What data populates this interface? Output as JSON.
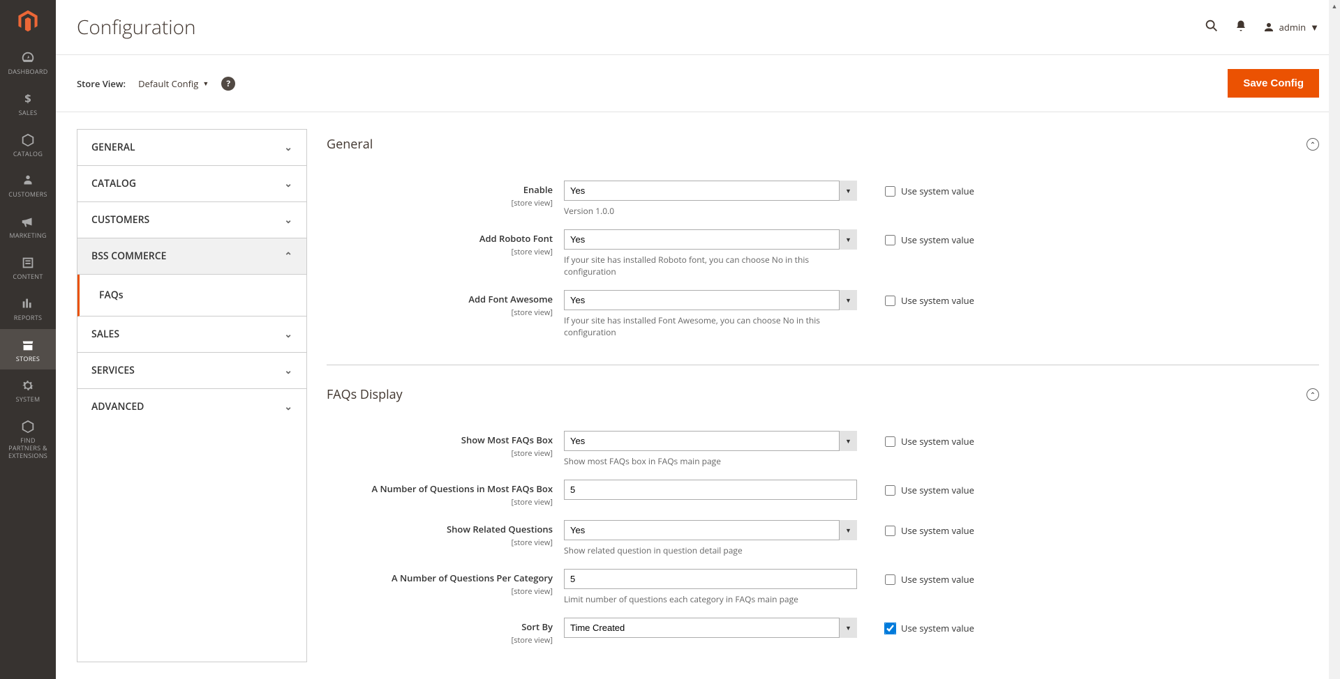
{
  "sidebar": {
    "items": [
      {
        "label": "DASHBOARD",
        "name": "nav-dashboard"
      },
      {
        "label": "SALES",
        "name": "nav-sales"
      },
      {
        "label": "CATALOG",
        "name": "nav-catalog"
      },
      {
        "label": "CUSTOMERS",
        "name": "nav-customers"
      },
      {
        "label": "MARKETING",
        "name": "nav-marketing"
      },
      {
        "label": "CONTENT",
        "name": "nav-content"
      },
      {
        "label": "REPORTS",
        "name": "nav-reports"
      },
      {
        "label": "STORES",
        "name": "nav-stores"
      },
      {
        "label": "SYSTEM",
        "name": "nav-system"
      },
      {
        "label": "FIND PARTNERS & EXTENSIONS",
        "name": "nav-partners"
      }
    ]
  },
  "header": {
    "title": "Configuration",
    "user": "admin"
  },
  "toolbar": {
    "store_view_label": "Store View:",
    "store_view_value": "Default Config",
    "save_label": "Save Config"
  },
  "config_nav": {
    "tabs": [
      {
        "label": "GENERAL",
        "expanded": false
      },
      {
        "label": "CATALOG",
        "expanded": false
      },
      {
        "label": "CUSTOMERS",
        "expanded": false
      },
      {
        "label": "BSS COMMERCE",
        "expanded": true,
        "sub": [
          {
            "label": "FAQs",
            "active": true
          }
        ]
      },
      {
        "label": "SALES",
        "expanded": false
      },
      {
        "label": "SERVICES",
        "expanded": false
      },
      {
        "label": "ADVANCED",
        "expanded": false
      }
    ]
  },
  "sections": {
    "general": {
      "title": "General",
      "fields": {
        "enable": {
          "label": "Enable",
          "scope": "[store view]",
          "value": "Yes",
          "note": "Version 1.0.0",
          "use_default_label": "Use system value"
        },
        "roboto": {
          "label": "Add Roboto Font",
          "scope": "[store view]",
          "value": "Yes",
          "note": "If your site has installed Roboto font, you can choose No in this configuration",
          "use_default_label": "Use system value"
        },
        "fontawesome": {
          "label": "Add Font Awesome",
          "scope": "[store view]",
          "value": "Yes",
          "note": "If your site has installed Font Awesome, you can choose No in this configuration",
          "use_default_label": "Use system value"
        }
      }
    },
    "faqs_display": {
      "title": "FAQs Display",
      "fields": {
        "show_most": {
          "label": "Show Most FAQs Box",
          "scope": "[store view]",
          "value": "Yes",
          "note": "Show most FAQs box in FAQs main page",
          "use_default_label": "Use system value"
        },
        "num_most": {
          "label": "A Number of Questions in Most FAQs Box",
          "scope": "[store view]",
          "value": "5",
          "use_default_label": "Use system value"
        },
        "show_related": {
          "label": "Show Related Questions",
          "scope": "[store view]",
          "value": "Yes",
          "note": "Show related question in question detail page",
          "use_default_label": "Use system value"
        },
        "num_cat": {
          "label": "A Number of Questions Per Category",
          "scope": "[store view]",
          "value": "5",
          "note": "Limit number of questions each category in FAQs main page",
          "use_default_label": "Use system value"
        },
        "sort_by": {
          "label": "Sort By",
          "scope": "[store view]",
          "value": "Time Created",
          "use_default_label": "Use system value",
          "checked": true
        }
      }
    }
  }
}
